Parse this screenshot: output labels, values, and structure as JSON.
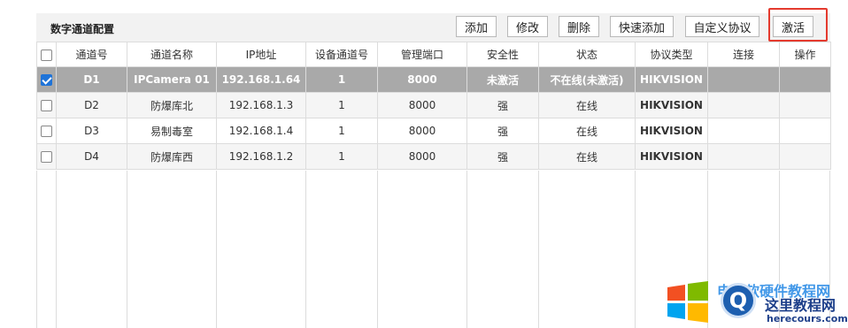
{
  "panel": {
    "title": "数字通道配置",
    "buttons": {
      "add": "添加",
      "edit": "修改",
      "delete": "删除",
      "quick_add": "快速添加",
      "custom_protocol": "自定义协议",
      "activate": "激活"
    }
  },
  "table": {
    "headers": [
      "通道号",
      "通道名称",
      "IP地址",
      "设备通道号",
      "管理端口",
      "安全性",
      "状态",
      "协议类型",
      "连接",
      "操作"
    ],
    "rows": [
      {
        "checked": true,
        "channel": "D1",
        "name": "IPCamera 01",
        "ip": "192.168.1.64",
        "dev_channel": "1",
        "port": "8000",
        "security": "未激活",
        "status": "不在线(未激活)",
        "protocol": "HIKVISION"
      },
      {
        "checked": false,
        "channel": "D2",
        "name": "防爆库北",
        "ip": "192.168.1.3",
        "dev_channel": "1",
        "port": "8000",
        "security": "强",
        "status": "在线",
        "protocol": "HIKVISION"
      },
      {
        "checked": false,
        "channel": "D3",
        "name": "易制毒室",
        "ip": "192.168.1.4",
        "dev_channel": "1",
        "port": "8000",
        "security": "强",
        "status": "在线",
        "protocol": "HIKVISION"
      },
      {
        "checked": false,
        "channel": "D4",
        "name": "防爆库西",
        "ip": "192.168.1.2",
        "dev_channel": "1",
        "port": "8000",
        "security": "强",
        "status": "在线",
        "protocol": "HIKVISION"
      }
    ]
  },
  "watermark": {
    "line1": "电脑软硬件教程网",
    "line2": "这里教程网",
    "line3": "herecours.com",
    "logo_letter": "Q"
  },
  "colors": {
    "selected_row": "#a9a9a9",
    "highlight_box": "#e43a2e",
    "checkbox_checked": "#1e73d8"
  }
}
